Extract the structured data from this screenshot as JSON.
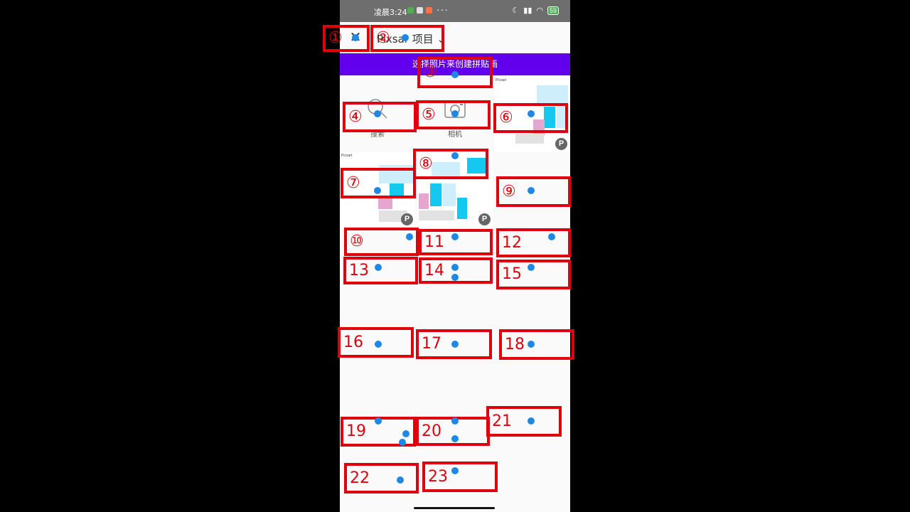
{
  "status": {
    "time": "凌晨3:24",
    "dots": "···",
    "battery": "59"
  },
  "header": {
    "close_glyph": "✕",
    "project": "Pixsar 项目",
    "chevron": "⌄"
  },
  "banner": {
    "text": "选择照片来创建拼贴画"
  },
  "tools": [
    {
      "label": "搜索",
      "icon": "search-icon"
    },
    {
      "label": "相机",
      "icon": "camera-icon"
    }
  ],
  "thumb_header": "Picsart",
  "annotations": [
    "①",
    "②",
    "③",
    "④",
    "⑤",
    "⑥",
    "⑦",
    "⑧",
    "⑨",
    "⑩",
    "11",
    "12",
    "13",
    "14",
    "15",
    "16",
    "17",
    "18",
    "19",
    "20",
    "21",
    "22",
    "23"
  ],
  "colors": {
    "accent": "#6200ee",
    "marker": "#e0000d",
    "dot": "#1e88e5",
    "status_bar": "#6e6e6e"
  }
}
